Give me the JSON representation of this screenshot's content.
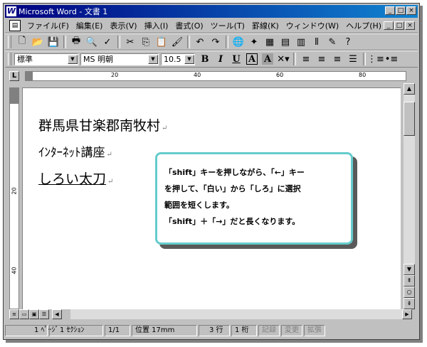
{
  "window": {
    "app_icon": "W",
    "title": "Microsoft Word - 文書 1",
    "buttons": {
      "minimize": "_",
      "maximize": "□",
      "close": "×"
    }
  },
  "menu": {
    "items": [
      {
        "label": "ファイル(F)"
      },
      {
        "label": "編集(E)"
      },
      {
        "label": "表示(V)"
      },
      {
        "label": "挿入(I)"
      },
      {
        "label": "書式(O)"
      },
      {
        "label": "ツール(T)"
      },
      {
        "label": "罫線(K)"
      },
      {
        "label": "ウィンドウ(W)"
      },
      {
        "label": "ヘルプ(H)"
      }
    ]
  },
  "toolbar_standard": {
    "icons": [
      "new-icon",
      "open-icon",
      "save-icon",
      "print-icon",
      "print-preview-icon",
      "spelling-icon",
      "cut-icon",
      "copy-icon",
      "paste-icon",
      "format-painter-icon",
      "undo-icon",
      "redo-icon",
      "hyperlink-icon",
      "web-toolbar-icon",
      "table-icon",
      "insert-table-icon",
      "excel-icon",
      "columns-icon",
      "drawing-icon",
      "help-icon"
    ]
  },
  "toolbar_format": {
    "style_value": "標準",
    "font_value": "MS 明朝",
    "size_value": "10.5",
    "bold": "B",
    "italic": "I",
    "underline": "U",
    "border_char": "A",
    "shade_char": "A"
  },
  "ruler": {
    "marks": [
      "20",
      "40",
      "60",
      "80"
    ],
    "vmarks": [
      "20",
      "40"
    ],
    "corner": "L"
  },
  "document": {
    "line1": "群馬県甘楽郡南牧村",
    "line2": "ｲﾝﾀｰﾈｯﾄ講座",
    "line3_selected": "しろい",
    "line3_rest": "太刀",
    "para_mark": "↵"
  },
  "callout": {
    "lines": [
      "「shift」キーを押しながら、「←」キー",
      "を押して、「白い」から「しろ」に選択",
      "範囲を短くします。",
      "「shift」＋「→」だと長くなります。"
    ]
  },
  "status": {
    "page": "1 ﾍﾟｰｼﾞ",
    "section": "1 ｾｸｼｮﾝ",
    "pages": "1/1",
    "position": "位置 17mm",
    "line": "3 行",
    "column": "1 桁",
    "rec": "記録",
    "trk": "変更",
    "ext": "拡張"
  }
}
